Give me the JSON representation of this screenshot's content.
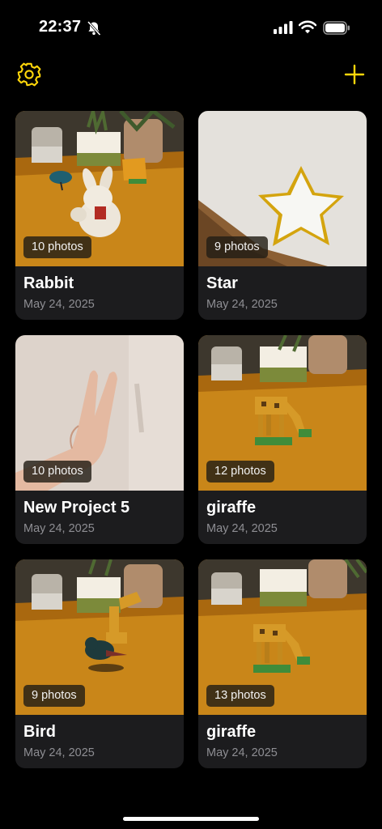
{
  "status_bar": {
    "time": "22:37",
    "icons": [
      "bell-slash-icon",
      "cellular-signal-icon",
      "wifi-icon",
      "battery-icon"
    ]
  },
  "toolbar": {
    "settings_icon": "gear-icon",
    "add_icon": "plus-icon",
    "accent_color": "#ffd60a"
  },
  "projects": [
    {
      "title": "Rabbit",
      "date": "May 24, 2025",
      "photo_count": "10 photos"
    },
    {
      "title": "Star",
      "date": "May 24, 2025",
      "photo_count": "9 photos"
    },
    {
      "title": "New Project 5",
      "date": "May 24, 2025",
      "photo_count": "10 photos"
    },
    {
      "title": "giraffe",
      "date": "May 24, 2025",
      "photo_count": "12 photos"
    },
    {
      "title": "Bird",
      "date": "May 24, 2025",
      "photo_count": "9 photos"
    },
    {
      "title": "giraffe",
      "date": "May 24, 2025",
      "photo_count": "13 photos"
    }
  ]
}
